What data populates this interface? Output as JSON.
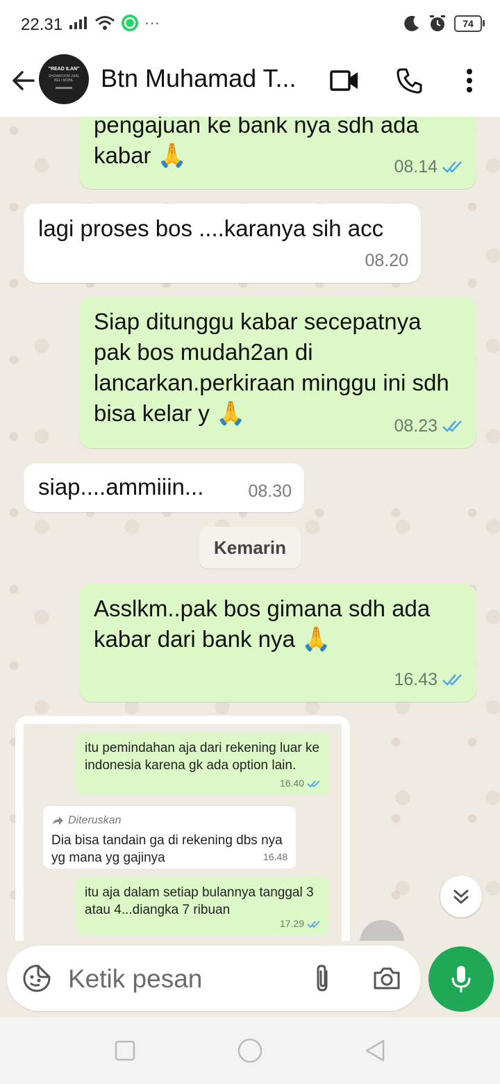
{
  "status_bar": {
    "time": "22.31",
    "battery": "74"
  },
  "header": {
    "contact_name": "Btn Muhamad T...",
    "avatar_text": "\"READ ILAN\"",
    "avatar_sub": "SHOWROOM JUAL BELI MOBIL"
  },
  "messages": [
    {
      "dir": "out",
      "text": "pengajuan ke bank nya sdh ada kabar",
      "emoji": "🙏",
      "time": "08.14",
      "ticks": "read"
    },
    {
      "dir": "in",
      "text": "lagi proses bos ....karanya sih acc",
      "time": "08.20"
    },
    {
      "dir": "out",
      "text": "Siap ditunggu kabar secepatnya pak bos mudah2an di lancarkan.perkiraan minggu ini sdh bisa kelar y",
      "emoji": "🙏",
      "time": "08.23",
      "ticks": "read"
    },
    {
      "dir": "in",
      "text": "siap....ammiiin...",
      "time": "08.30"
    },
    {
      "dir": "out",
      "text": "Asslkm..pak bos gimana sdh ada kabar dari bank nya",
      "emoji": "🙏",
      "time": "16.43",
      "ticks": "read"
    }
  ],
  "day_divider": "Kemarin",
  "image_message": {
    "items": [
      {
        "dir": "out",
        "text": "itu pemindahan aja dari rekening luar ke indonesia karena gk ada option lain.",
        "time": "16.40"
      },
      {
        "dir": "in",
        "forwarded_label": "Diteruskan",
        "text": "Dia bisa tandain ga di rekening dbs nya yg mana yg gajinya",
        "time": "16.48"
      },
      {
        "dir": "out",
        "text": "itu aja dalam setiap bulannya tanggal  3 atau 4...diangka 7 ribuan",
        "time": "17.29"
      }
    ]
  },
  "composer": {
    "placeholder": "Ketik pesan"
  },
  "colors": {
    "outgoing": "#dbf8c6",
    "incoming": "#ffffff",
    "accent": "#1fa855",
    "read_tick": "#4fa6e8"
  },
  "icons": [
    "back-arrow-icon",
    "video-call-icon",
    "phone-icon",
    "more-vert-icon",
    "sticker-icon",
    "paperclip-icon",
    "camera-icon",
    "mic-icon",
    "chevron-double-down-icon"
  ]
}
